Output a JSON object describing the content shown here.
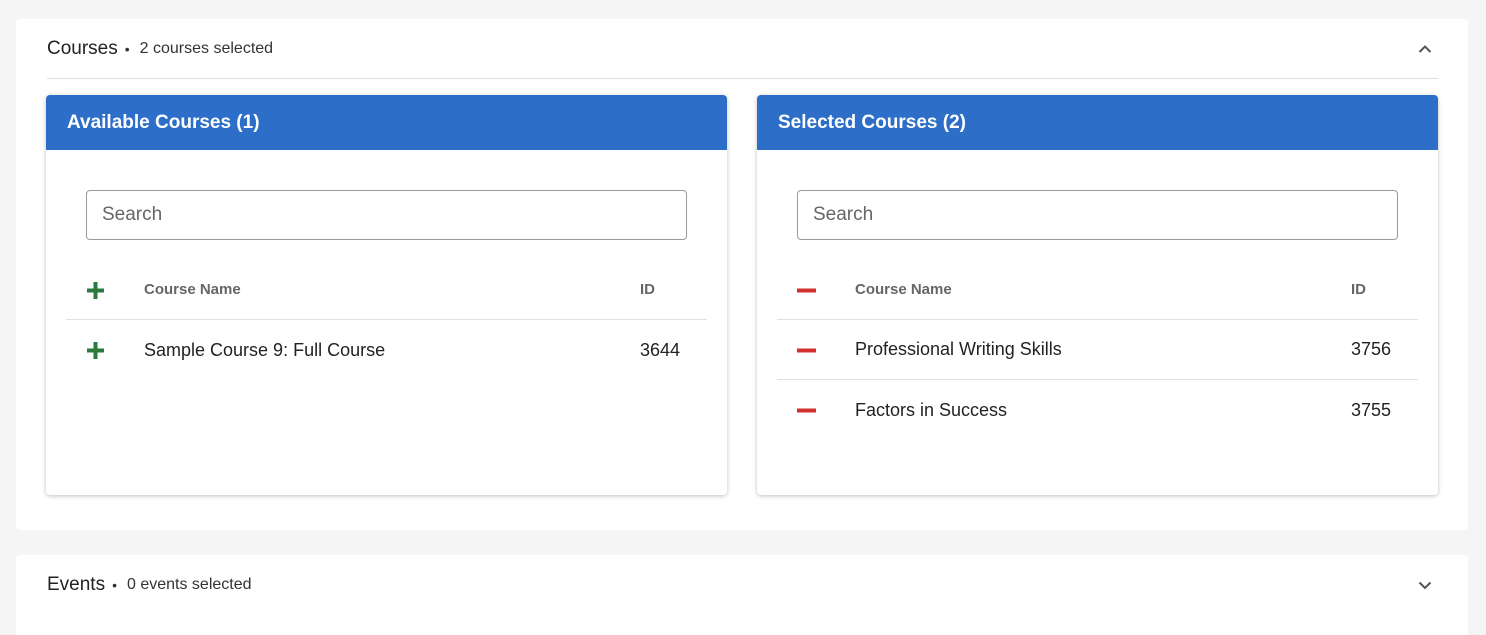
{
  "courses_section": {
    "title": "Courses",
    "separator": "•",
    "summary": "2 courses selected",
    "expanded": true
  },
  "available": {
    "title": "Available Courses (1)",
    "search_placeholder": "Search",
    "columns": {
      "name": "Course Name",
      "id": "ID"
    },
    "rows": [
      {
        "name": "Sample Course 9: Full Course",
        "id": "3644"
      }
    ]
  },
  "selected": {
    "title": "Selected Courses (2)",
    "search_placeholder": "Search",
    "columns": {
      "name": "Course Name",
      "id": "ID"
    },
    "rows": [
      {
        "name": "Professional Writing Skills",
        "id": "3756"
      },
      {
        "name": "Factors in Success",
        "id": "3755"
      }
    ]
  },
  "events_section": {
    "title": "Events",
    "separator": "•",
    "summary": "0 events selected",
    "expanded": false
  },
  "colors": {
    "panel_header": "#2c6ec8",
    "add_icon": "#2a7a3e",
    "remove_icon": "#d32f2f",
    "page_bg": "#f5f5f5"
  },
  "icons": {
    "add": "plus-icon",
    "remove": "minus-icon",
    "collapse": "chevron-up-icon",
    "expand": "chevron-down-icon"
  }
}
